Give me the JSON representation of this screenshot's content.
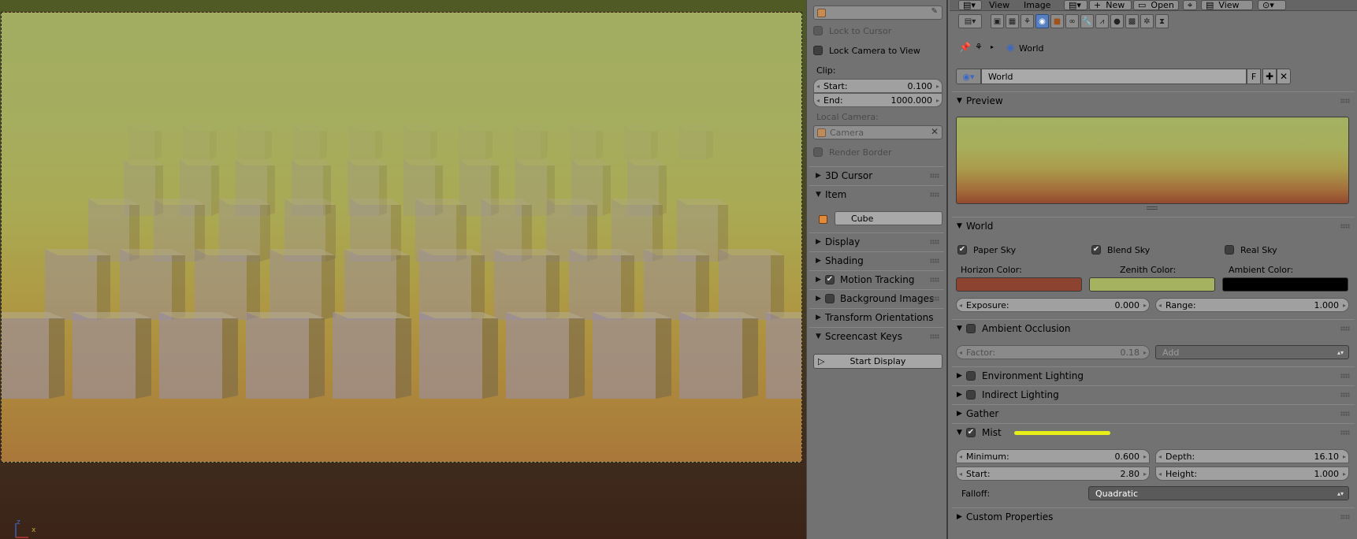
{
  "viewport": {
    "axis_x_label": "x",
    "axis_z_label": "z"
  },
  "npanel": {
    "lock_to_cursor": "Lock to Cursor",
    "lock_camera_to_view": "Lock Camera to View",
    "clip_label": "Clip:",
    "clip_start_label": "Start:",
    "clip_start_value": "0.100",
    "clip_end_label": "End:",
    "clip_end_value": "1000.000",
    "local_camera_label": "Local Camera:",
    "local_camera_placeholder": "Camera",
    "render_border": "Render Border",
    "panels": {
      "cursor_3d": "3D Cursor",
      "item": "Item",
      "item_name": "Cube",
      "display": "Display",
      "shading": "Shading",
      "motion_tracking": "Motion Tracking",
      "background_images": "Background Images",
      "transform_orientations": "Transform Orientations",
      "screencast_keys": "Screencast Keys",
      "start_display": "Start Display"
    }
  },
  "topbar": {
    "view": "View",
    "image": "Image",
    "new": "New",
    "open": "Open",
    "view2": "View"
  },
  "props": {
    "breadcrumb": "World",
    "world_name": "World",
    "fake_user": "F",
    "preview_label": "Preview",
    "world_panel": "World",
    "paper_sky": "Paper Sky",
    "blend_sky": "Blend Sky",
    "real_sky": "Real Sky",
    "horizon_color_label": "Horizon Color:",
    "zenith_color_label": "Zenith Color:",
    "ambient_color_label": "Ambient Color:",
    "colors": {
      "horizon": "#8c4330",
      "zenith": "#a5b361",
      "ambient": "#000000"
    },
    "exposure_label": "Exposure:",
    "exposure_value": "0.000",
    "range_label": "Range:",
    "range_value": "1.000",
    "ambient_occlusion": "Ambient Occlusion",
    "factor_label": "Factor:",
    "factor_value": "0.18",
    "ao_mode": "Add",
    "environment_lighting": "Environment Lighting",
    "indirect_lighting": "Indirect Lighting",
    "gather": "Gather",
    "mist": "Mist",
    "mist_minimum_label": "Minimum:",
    "mist_minimum_value": "0.600",
    "mist_depth_label": "Depth:",
    "mist_depth_value": "16.10",
    "mist_start_label": "Start:",
    "mist_start_value": "2.80",
    "mist_height_label": "Height:",
    "mist_height_value": "1.000",
    "falloff_label": "Falloff:",
    "falloff_value": "Quadratic",
    "custom_properties": "Custom Properties"
  }
}
